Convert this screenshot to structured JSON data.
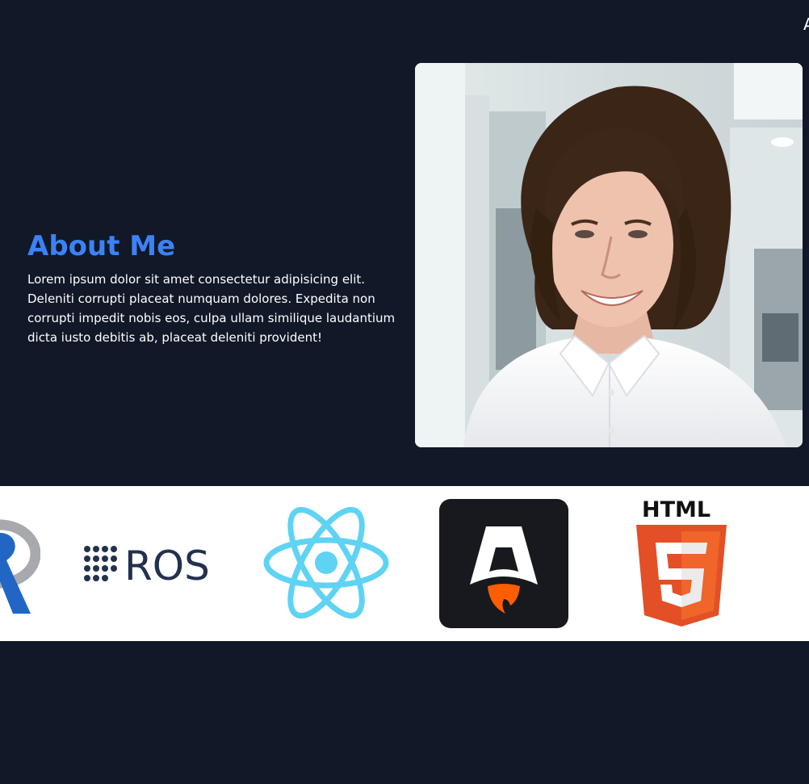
{
  "nav": {
    "edge_text": "A"
  },
  "about": {
    "title": "About Me",
    "body": "Lorem ipsum dolor sit amet consectetur adipisicing elit. Deleniti corrupti placeat numquam dolores. Expedita non corrupti impedit nobis eos, culpa ullam similique laudantium dicta iusto debitis ab, placeat deleniti provident!"
  },
  "colors": {
    "page_background": "#111827",
    "accent": "#3b82f6",
    "strip_background": "#ffffff"
  },
  "logos": {
    "r": {
      "icon": "r-logo"
    },
    "ros": {
      "icon": "ros-logo",
      "text": "ROS"
    },
    "react": {
      "icon": "react-logo"
    },
    "astro": {
      "icon": "astro-logo"
    },
    "html": {
      "icon": "html5-logo",
      "word": "HTML",
      "digit": "5"
    }
  }
}
